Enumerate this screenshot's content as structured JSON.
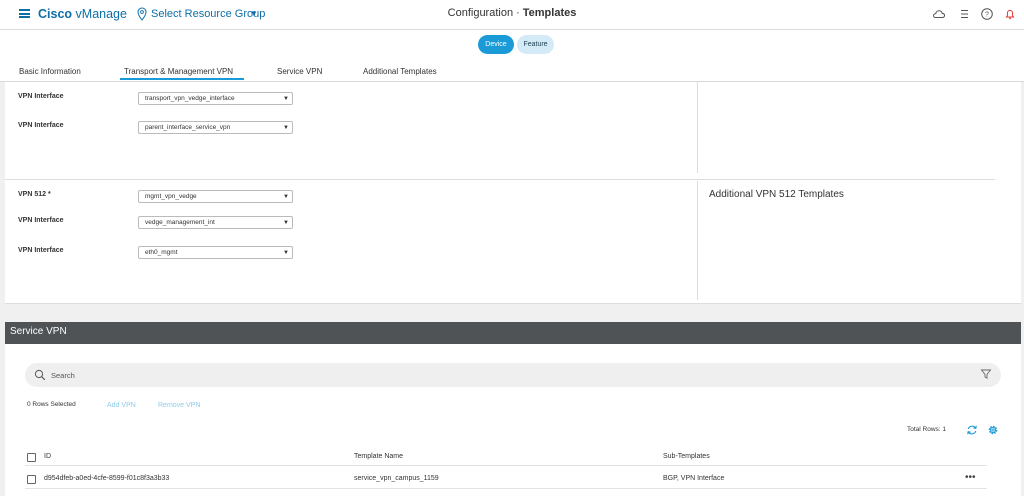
{
  "header": {
    "brand_bold": "Cisco",
    "brand_rest": "vManage",
    "resource_group": "Select Resource Group",
    "title_section": "Configuration",
    "title_separator": "·",
    "title_page": "Templates"
  },
  "toggle": {
    "device": "Device",
    "feature": "Feature"
  },
  "tabs": [
    {
      "label": "Basic Information"
    },
    {
      "label": "Transport & Management VPN",
      "active": true
    },
    {
      "label": "Service VPN"
    },
    {
      "label": "Additional Templates"
    }
  ],
  "transport_fields": [
    {
      "label": "VPN Interface",
      "value": "transport_vpn_vedge_interface"
    },
    {
      "label": "VPN Interface",
      "value": "parent_interface_service_vpn"
    }
  ],
  "mgmt_fields": [
    {
      "label": "VPN 512 *",
      "value": "mgmt_vpn_vedge"
    },
    {
      "label": "VPN Interface",
      "value": "vedge_management_int"
    },
    {
      "label": "VPN Interface",
      "value": "eth0_mgmt"
    }
  ],
  "additional_vpn512": "Additional VPN 512 Templates",
  "service_vpn": {
    "title": "Service VPN",
    "search_placeholder": "Search",
    "rows_selected": "0 Rows Selected",
    "add_vpn": "Add VPN",
    "remove_vpn": "Remove VPN",
    "total_rows": "Total Rows: 1",
    "columns": [
      "ID",
      "Template Name",
      "Sub-Templates"
    ],
    "rows": [
      {
        "id": "d954dfeb-a0ed-4cfe-8599-f01c8f3a3b33",
        "template_name": "service_vpn_campus_1159",
        "sub_templates": "BGP, VPN Interface",
        "actions": "•••"
      }
    ]
  },
  "colors": {
    "brand": "#0d6ea8",
    "accent": "#1a9bd7",
    "section_header": "#4f5356",
    "disabled_link": "#8fcbe8"
  }
}
